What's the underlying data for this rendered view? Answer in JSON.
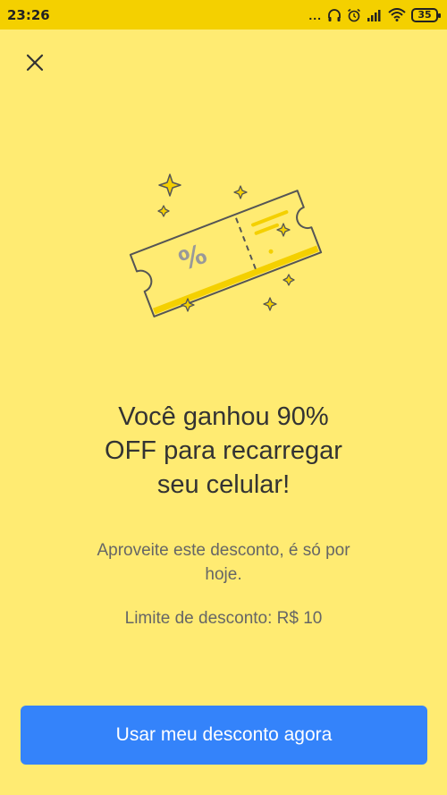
{
  "status_bar": {
    "time": "23:26",
    "dots": "...",
    "battery_level": "35",
    "icons": [
      "headphones-icon",
      "alarm-icon",
      "signal-icon",
      "wifi-icon",
      "battery-icon"
    ]
  },
  "header": {
    "close_icon": "close-icon"
  },
  "promo": {
    "illustration": "coupon-ticket-icon",
    "ticket_symbol": "%",
    "headline_line1": "Você ganhou 90%",
    "headline_line2": "OFF para recarregar",
    "headline_line3": "seu celular!",
    "subtext_line1": "Aproveite este desconto, é só por",
    "subtext_line2": "hoje.",
    "limit": "Limite de desconto: R$ 10"
  },
  "actions": {
    "cta_label": "Usar meu desconto agora"
  },
  "colors": {
    "background": "#FFEB72",
    "status_bar": "#F4D000",
    "cta": "#3483FA",
    "ticket_accent": "#F4D000"
  }
}
